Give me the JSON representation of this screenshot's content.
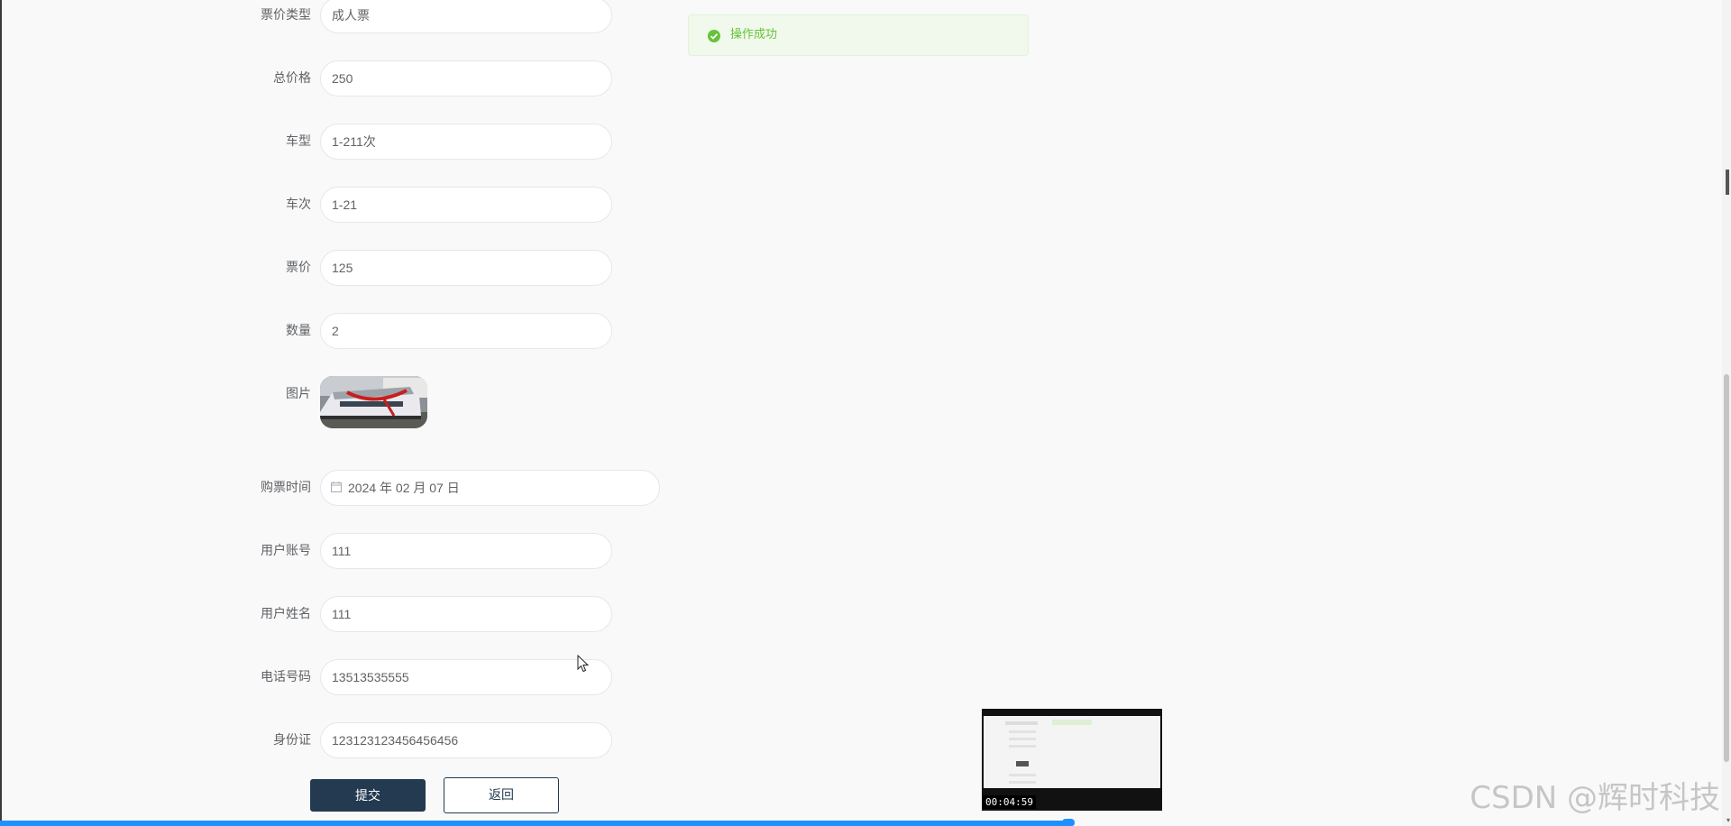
{
  "form": {
    "fields": [
      {
        "label": "票价类型",
        "value": "成人票"
      },
      {
        "label": "总价格",
        "value": "250"
      },
      {
        "label": "车型",
        "value": "1-211次"
      },
      {
        "label": "车次",
        "value": "1-21"
      },
      {
        "label": "票价",
        "value": "125"
      },
      {
        "label": "数量",
        "value": "2"
      },
      {
        "label": "图片"
      },
      {
        "label": "购票时间",
        "value": "2024 年 02 月 07 日"
      },
      {
        "label": "用户账号",
        "value": "111"
      },
      {
        "label": "用户姓名",
        "value": "111"
      },
      {
        "label": "电话号码",
        "value": "13513535555"
      },
      {
        "label": "身份证",
        "value": "123123123456456456"
      }
    ],
    "submit_label": "提交",
    "back_label": "返回"
  },
  "toast": {
    "message": "操作成功",
    "color": "#67c23a"
  },
  "video": {
    "time": "00:04:59"
  },
  "watermark": "CSDN @辉时科技",
  "colors": {
    "primary": "#233a50",
    "success": "#67c23a",
    "progress": "#1e90ff"
  },
  "icons": {
    "calendar": "calendar-icon",
    "success": "check-circle-icon"
  }
}
